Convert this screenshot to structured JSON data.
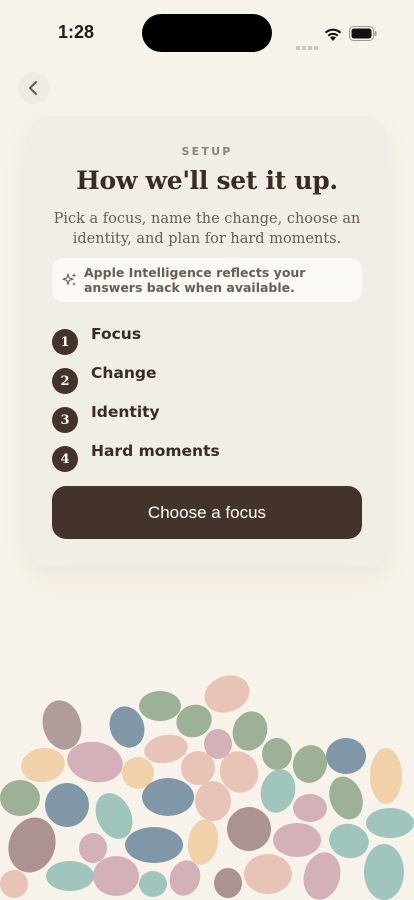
{
  "status_bar": {
    "time": "1:28"
  },
  "nav": {
    "back_icon": "chevron-left-icon"
  },
  "card": {
    "eyebrow": "SETUP",
    "title": "How we'll set it up.",
    "subtitle": "Pick a focus, name the change, choose an identity, and plan for hard moments.",
    "ai_note": {
      "icon": "sparkles-icon",
      "text": "Apple Intelligence reflects your answers back when available."
    },
    "steps": [
      {
        "number": "1",
        "label": "Focus"
      },
      {
        "number": "2",
        "label": "Change"
      },
      {
        "number": "3",
        "label": "Identity"
      },
      {
        "number": "4",
        "label": "Hard moments"
      }
    ],
    "cta_label": "Choose a focus"
  },
  "colors": {
    "background": "#f8f3ea",
    "card": "#f1eee8",
    "primary": "#43332a",
    "pebbles": [
      "#b09c9b",
      "#7f97a6",
      "#9db196",
      "#e7c4b6",
      "#d8afbb",
      "#9fc5bd",
      "#f1d1a9",
      "#ac9392",
      "#d4b0b8",
      "#bfb0c4"
    ]
  }
}
